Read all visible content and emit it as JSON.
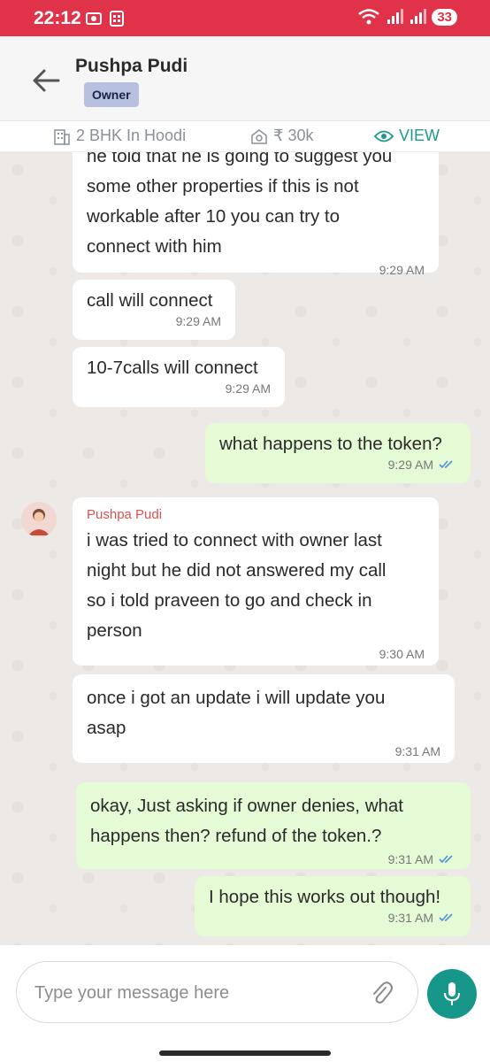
{
  "status_bar": {
    "time": "22:12",
    "battery": "33"
  },
  "header": {
    "contact_name": "Pushpa Pudi",
    "role": "Owner"
  },
  "property": {
    "type": "2 BHK In Hoodi",
    "rent": "₹ 30k",
    "view_label": "VIEW"
  },
  "messages": [
    {
      "id": "m1",
      "dir": "in",
      "lines": [
        "he told that he is going to suggest you",
        "some other properties if this is not",
        "workable after 10 you can try to",
        "connect with him"
      ],
      "time": "9:29 AM"
    },
    {
      "id": "m2",
      "dir": "in",
      "text": "call will connect",
      "time": "9:29 AM"
    },
    {
      "id": "m3",
      "dir": "in",
      "text": "10-7calls will connect",
      "time": "9:29 AM"
    },
    {
      "id": "m4",
      "dir": "out",
      "text": "what happens to the token?",
      "time": "9:29 AM"
    },
    {
      "id": "m5",
      "dir": "in",
      "sender": "Pushpa Pudi",
      "lines": [
        "i was tried to connect with owner last",
        "night but he did not answered my call",
        "so i told praveen to go and check in",
        "person"
      ],
      "time": "9:30 AM"
    },
    {
      "id": "m6",
      "dir": "in",
      "lines": [
        "once i got an update i will update you",
        "asap"
      ],
      "time": "9:31 AM"
    },
    {
      "id": "m7",
      "dir": "out",
      "lines": [
        "okay, Just asking if owner denies, what",
        "happens then? refund of the token.?"
      ],
      "time": "9:31 AM"
    },
    {
      "id": "m8",
      "dir": "out",
      "text": "I hope this works out though!",
      "time": "9:31 AM"
    }
  ],
  "composer": {
    "placeholder": "Type your message here"
  },
  "colors": {
    "status_bar": "#e0334a",
    "accent": "#17978a",
    "outgoing_bubble": "#e4fbd6",
    "badge": "#b8c0e0"
  }
}
